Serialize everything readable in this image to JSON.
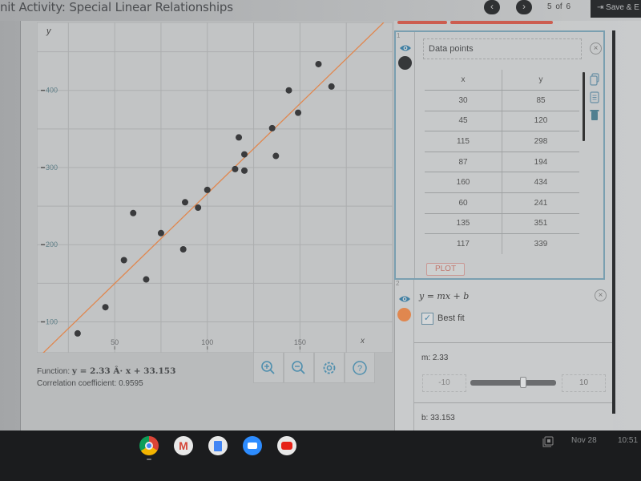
{
  "window": {
    "title": "nit Activity: Special Linear Relationships",
    "prev_icon": "chevron-left-icon",
    "next_icon": "chevron-right-icon",
    "page_indicator": "5  of  6",
    "save_label": "Save & E"
  },
  "graph": {
    "function_label": "Function:",
    "function_expr": "y = 2.33 Â· x + 33.153",
    "correlation_label": "Correlation coefficient: 0.9595",
    "tools": [
      {
        "name": "zoom-in",
        "icon": "zoom-in-icon"
      },
      {
        "name": "zoom-out",
        "icon": "zoom-out-icon"
      },
      {
        "name": "settings",
        "icon": "gear-icon"
      },
      {
        "name": "help",
        "icon": "help-icon"
      }
    ]
  },
  "panel1": {
    "index": "1",
    "title": "Data points",
    "point_color": "#3a3b3d",
    "headers": [
      "x",
      "y"
    ],
    "rows": [
      [
        "30",
        "85"
      ],
      [
        "45",
        "120"
      ],
      [
        "115",
        "298"
      ],
      [
        "87",
        "194"
      ],
      [
        "160",
        "434"
      ],
      [
        "60",
        "241"
      ],
      [
        "135",
        "351"
      ],
      [
        "117",
        "339"
      ]
    ],
    "plot_label": "PLOT"
  },
  "panel2": {
    "index": "2",
    "equation": "y = mx + b",
    "line_color": "#e0874f",
    "best_fit_label": "Best fit",
    "best_fit_checked": true,
    "m_label": "m: 2.33",
    "m_value": 2.33,
    "slider_min": "-10",
    "slider_max": "10",
    "b_label": "b: 33.153"
  },
  "shelf": {
    "apps": [
      "Chrome",
      "Gmail",
      "Docs",
      "Zoom",
      "YouTube"
    ],
    "date": "Nov 28",
    "time": "10:51"
  },
  "chart_data": {
    "type": "scatter",
    "title": "",
    "xlabel": "x",
    "ylabel": "y",
    "xlim": [
      8,
      200
    ],
    "ylim": [
      60,
      488
    ],
    "x_ticks": [
      50,
      100,
      150
    ],
    "y_ticks": [
      100,
      200,
      300,
      400
    ],
    "x_tick_labels": [
      "50",
      "100",
      "150"
    ],
    "y_tick_labels": [
      "100",
      "200",
      "300",
      "400"
    ],
    "grid": true,
    "points": [
      [
        30,
        85
      ],
      [
        45,
        119
      ],
      [
        55,
        180
      ],
      [
        60,
        241
      ],
      [
        67,
        155
      ],
      [
        75,
        215
      ],
      [
        87,
        194
      ],
      [
        88,
        255
      ],
      [
        95,
        248
      ],
      [
        100,
        271
      ],
      [
        115,
        298
      ],
      [
        117,
        339
      ],
      [
        120,
        317
      ],
      [
        120,
        296
      ],
      [
        135,
        351
      ],
      [
        137,
        315
      ],
      [
        144,
        400
      ],
      [
        149,
        371
      ],
      [
        160,
        434
      ],
      [
        167,
        405
      ]
    ],
    "fit_line": {
      "slope": 2.33,
      "intercept": 33.153
    },
    "point_color": "#3a3b3d",
    "line_color": "#e0874f"
  }
}
